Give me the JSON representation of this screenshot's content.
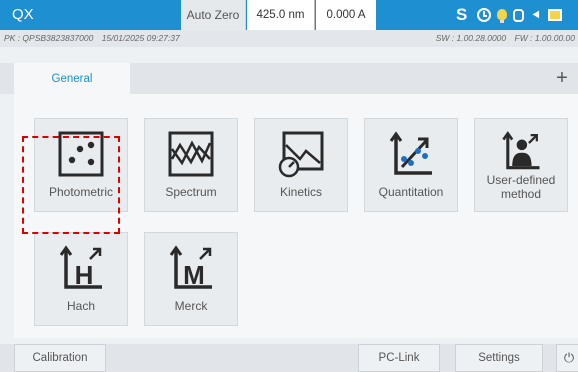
{
  "header": {
    "app_title": "QX",
    "auto_zero_label": "Auto Zero",
    "wavelength": "425.0 nm",
    "absorbance": "0.000 A",
    "status_letter": "S",
    "status_icons": [
      "clock-icon",
      "lamp-bulb-icon",
      "lamp-icon",
      "usb-icon",
      "display-icon"
    ]
  },
  "info": {
    "pk": "PK : QPSB3823837000",
    "datetime": "15/01/2025 09:27:37",
    "sw": "SW : 1.00.28.0000",
    "fw": "FW : 1.00.00.00"
  },
  "tabs": {
    "general": "General",
    "add": "+"
  },
  "methods": [
    {
      "id": "photometric",
      "label": "Photometric",
      "icon": "photometric-icon"
    },
    {
      "id": "spectrum",
      "label": "Spectrum",
      "icon": "spectrum-icon"
    },
    {
      "id": "kinetics",
      "label": "Kinetics",
      "icon": "kinetics-icon"
    },
    {
      "id": "quantitation",
      "label": "Quantitation",
      "icon": "quantitation-icon"
    },
    {
      "id": "user-defined",
      "label": "User-defined method",
      "icon": "user-defined-method-icon"
    },
    {
      "id": "hach",
      "label": "Hach",
      "icon": "hach-icon",
      "letter": "H"
    },
    {
      "id": "merck",
      "label": "Merck",
      "icon": "merck-icon",
      "letter": "M"
    }
  ],
  "footer": {
    "calibration": "Calibration",
    "pc_link": "PC-Link",
    "settings": "Settings",
    "power": "⏻"
  },
  "colors": {
    "accent": "#1e8fd0",
    "highlight": "#e00000",
    "icon_dark": "#2a2a2a",
    "icon_blue": "#1e6fc0"
  }
}
